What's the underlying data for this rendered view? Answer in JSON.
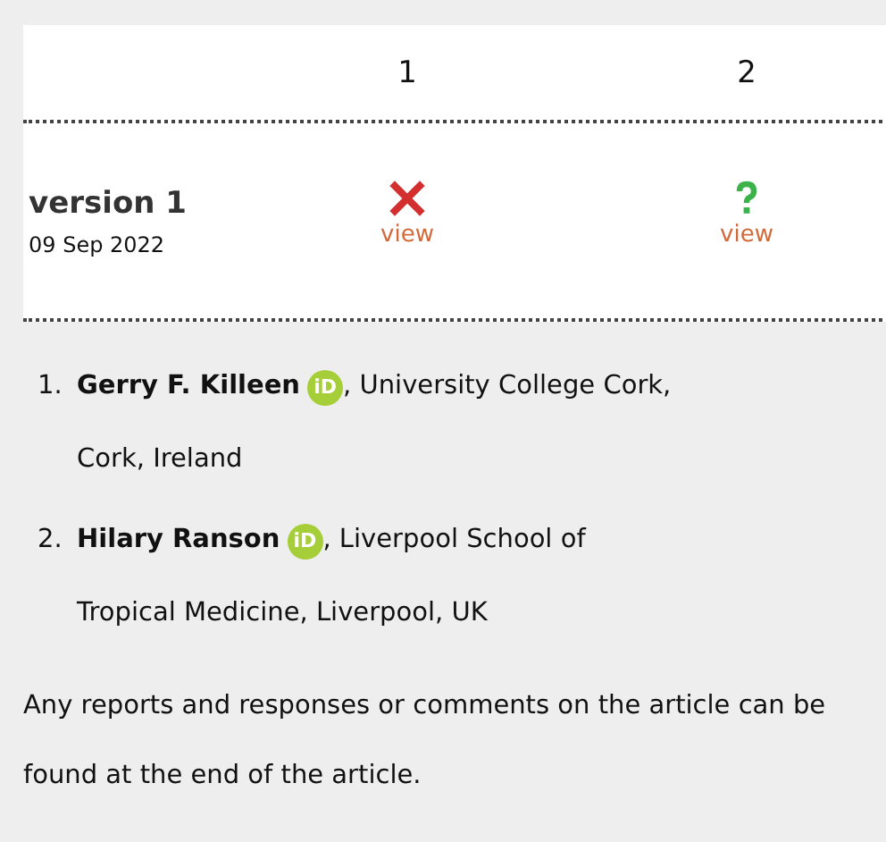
{
  "review_table": {
    "columns": [
      "1",
      "2"
    ],
    "rows": [
      {
        "version": "version 1",
        "date": "09 Sep 2022",
        "reports": [
          {
            "kind": "cross",
            "link": "view"
          },
          {
            "kind": "question",
            "link": "view"
          }
        ]
      }
    ]
  },
  "authors": [
    {
      "number": "1.",
      "name": "Gerry F. Killeen",
      "badge": "iD",
      "affiliation": [
        ", University College Cork,",
        "Cork, Ireland"
      ]
    },
    {
      "number": "2.",
      "name": "Hilary Ranson",
      "badge": "iD",
      "affiliation": [
        ", Liverpool School of",
        "Tropical Medicine, Liverpool, UK"
      ]
    }
  ],
  "note": "Any reports and responses or comments on the article can be found at the end of the article."
}
